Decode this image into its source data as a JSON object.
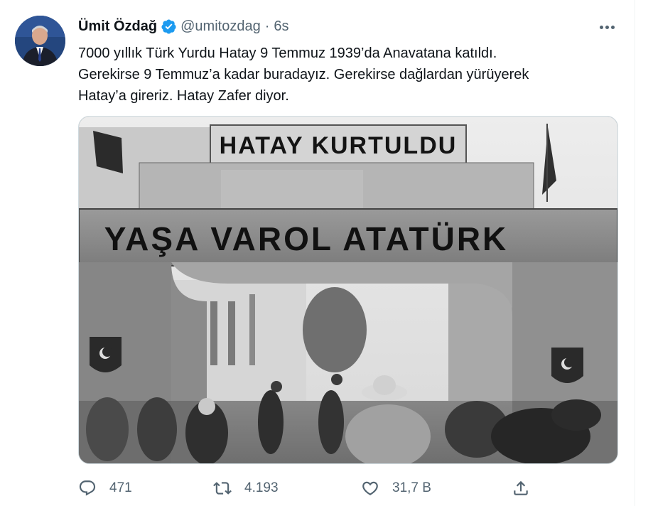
{
  "tweet": {
    "author_name": "Ümit Özdağ",
    "handle": "@umitozdag",
    "separator": "·",
    "time": "6s",
    "text_lines": [
      "7000 yıllık Türk Yurdu Hatay 9 Temmuz 1939’da Anavatana katıldı.",
      "Gerekirse 9 Temmuz’a kadar buradayız. Gerekirse dağlardan yürüyerek",
      "Hatay’a gireriz. Hatay Zafer diyor."
    ]
  },
  "photo": {
    "top_sign": "HATAY KURTULDU",
    "arch_sign": "YAŞA VAROL ATATÜRK"
  },
  "actions": {
    "replies": "471",
    "retweets": "4.193",
    "likes": "31,7 B"
  },
  "colors": {
    "verified": "#1d9bf0",
    "secondary_text": "#536471",
    "primary_text": "#0f1419"
  },
  "icons": [
    "verified-badge-icon",
    "more-icon",
    "reply-icon",
    "retweet-icon",
    "like-icon",
    "share-icon"
  ]
}
